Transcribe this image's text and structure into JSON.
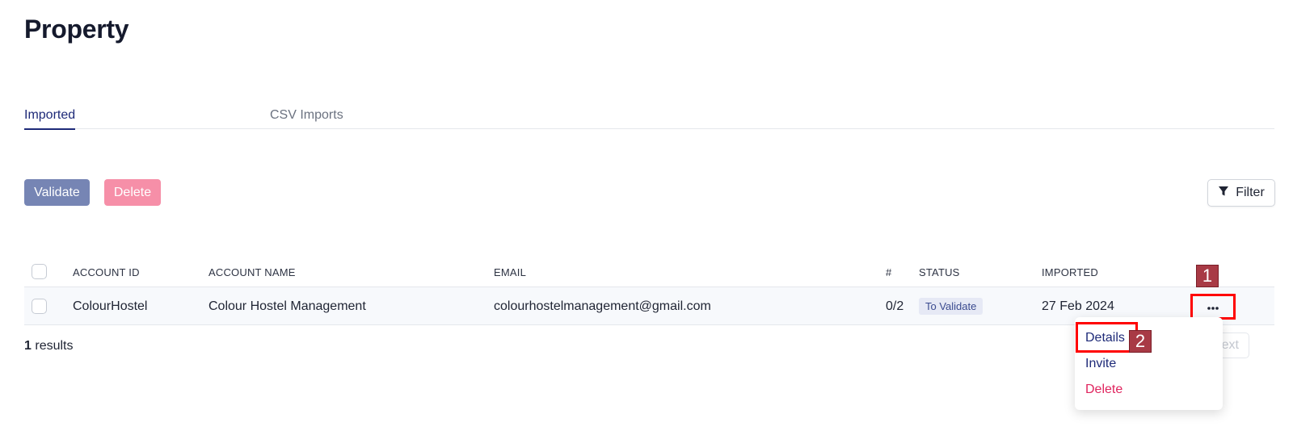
{
  "page": {
    "title": "Property"
  },
  "tabs": [
    {
      "label": "Imported",
      "active": true
    },
    {
      "label": "CSV Imports",
      "active": false
    }
  ],
  "toolbar": {
    "validate_label": "Validate",
    "delete_label": "Delete",
    "filter_label": "Filter",
    "filter_icon": "filter-funnel-icon"
  },
  "table": {
    "columns": [
      "ACCOUNT ID",
      "ACCOUNT NAME",
      "EMAIL",
      "#",
      "STATUS",
      "IMPORTED"
    ],
    "rows": [
      {
        "account_id": "ColourHostel",
        "account_name": "Colour Hostel Management",
        "email": "colourhostelmanagement@gmail.com",
        "count": "0/2",
        "status": "To Validate",
        "imported": "27 Feb 2024"
      }
    ]
  },
  "results": {
    "count": "1",
    "label": "results"
  },
  "pagination": {
    "next_label": "Next"
  },
  "row_menu": {
    "items": [
      {
        "label": "Details"
      },
      {
        "label": "Invite"
      },
      {
        "label": "Delete"
      }
    ]
  },
  "annotations": {
    "step_1": "1",
    "step_2": "2"
  },
  "colors": {
    "accent": "#1e2a78",
    "validate_button": "#7685b4",
    "delete_button": "#f68fa8",
    "danger_text": "#e0245e",
    "highlight": "#ff0000",
    "step_badge": "#a83a45"
  }
}
